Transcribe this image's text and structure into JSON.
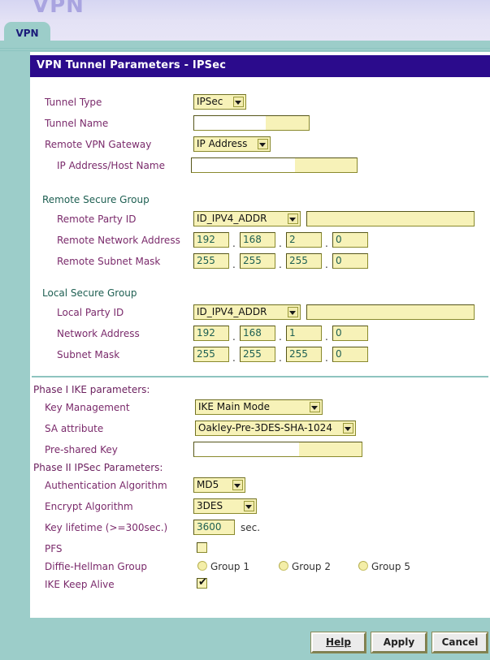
{
  "banner": {
    "title": "VPN"
  },
  "tab": {
    "label": "VPN"
  },
  "panel": {
    "header": "VPN Tunnel Parameters - IPSec"
  },
  "form": {
    "tunnel_type": {
      "label": "Tunnel Type",
      "value": "IPSec"
    },
    "tunnel_name": {
      "label": "Tunnel Name",
      "value": ""
    },
    "remote_vpn_gateway": {
      "label": "Remote VPN Gateway",
      "value": "IP Address"
    },
    "ip_address_host_name": {
      "label": "IP Address/Host Name",
      "value": ""
    },
    "remote_secure_group": {
      "label": "Remote Secure Group"
    },
    "remote_party_id": {
      "label": "Remote Party ID",
      "value": "ID_IPV4_ADDR",
      "text": ""
    },
    "remote_network_address": {
      "label": "Remote Network Address",
      "octets": [
        "192",
        "168",
        "2",
        "0"
      ]
    },
    "remote_subnet_mask": {
      "label": "Remote Subnet Mask",
      "octets": [
        "255",
        "255",
        "255",
        "0"
      ]
    },
    "local_secure_group": {
      "label": "Local Secure Group"
    },
    "local_party_id": {
      "label": "Local Party ID",
      "value": "ID_IPV4_ADDR",
      "text": ""
    },
    "network_address": {
      "label": "Network Address",
      "octets": [
        "192",
        "168",
        "1",
        "0"
      ]
    },
    "subnet_mask": {
      "label": "Subnet Mask",
      "octets": [
        "255",
        "255",
        "255",
        "0"
      ]
    },
    "phase1_heading": "Phase I IKE parameters:",
    "key_management": {
      "label": "Key Management",
      "value": "IKE Main Mode"
    },
    "sa_attribute": {
      "label": "SA attribute",
      "value": "Oakley-Pre-3DES-SHA-1024"
    },
    "pre_shared_key": {
      "label": "Pre-shared Key",
      "value": ""
    },
    "phase2_heading": "Phase II IPSec Parameters:",
    "authentication_algorithm": {
      "label": "Authentication Algorithm",
      "value": "MD5"
    },
    "encrypt_algorithm": {
      "label": "Encrypt Algorithm",
      "value": "3DES"
    },
    "key_lifetime": {
      "label": "Key lifetime (>=300sec.)",
      "value": "3600",
      "unit": "sec."
    },
    "pfs": {
      "label": "PFS",
      "checked": false
    },
    "diffie_hellman_group": {
      "label": "Diffie-Hellman Group",
      "options": [
        "Group 1",
        "Group 2",
        "Group 5"
      ],
      "selected": ""
    },
    "ike_keep_alive": {
      "label": "IKE Keep Alive",
      "checked": true,
      "tick": "✔"
    }
  },
  "footer": {
    "help": "Help",
    "apply": "Apply",
    "cancel": "Cancel"
  },
  "colors": {
    "page_bg": "#9ccdc9",
    "header_bar": "#2b0b8c",
    "field_bg": "#f7f2b8",
    "field_border": "#8a8a2e",
    "label_purple": "#7a2a6b",
    "label_teal": "#1e5f52"
  }
}
